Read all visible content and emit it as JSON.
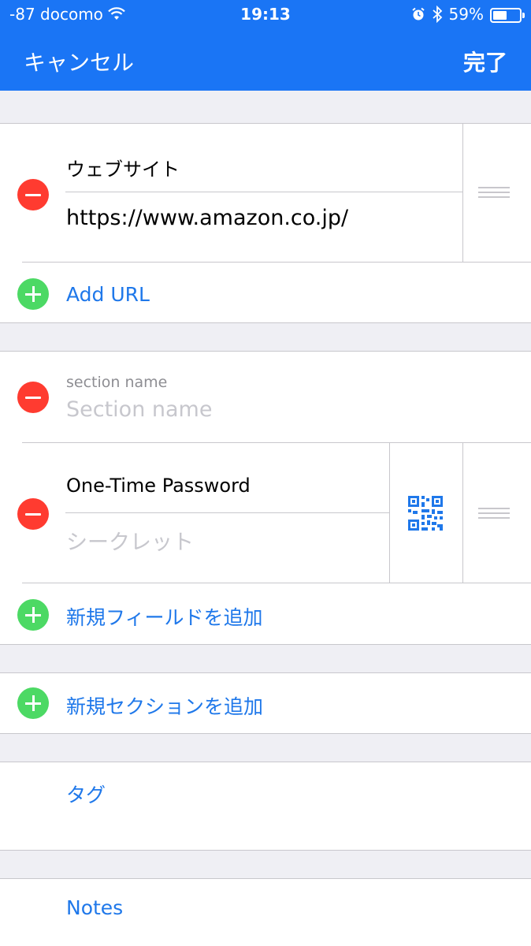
{
  "status_bar": {
    "carrier": "-87 docomo",
    "time": "19:13",
    "battery": "59%",
    "battery_level": 0.59,
    "icons": [
      "wifi-icon",
      "alarm-icon",
      "bluetooth-icon",
      "battery-icon"
    ]
  },
  "nav": {
    "cancel": "キャンセル",
    "done": "完了"
  },
  "website": {
    "label": "ウェブサイト",
    "value": "https://www.amazon.co.jp/",
    "add_url": "Add URL"
  },
  "section": {
    "name_label": "section name",
    "name_placeholder": "Section name",
    "otp_label": "One-Time Password",
    "secret_placeholder": "シークレット",
    "add_field": "新規フィールドを追加"
  },
  "add_section": "新規セクションを追加",
  "tags_label": "タグ",
  "notes_label": "Notes",
  "colors": {
    "nav_blue": "#1a75f5",
    "link_blue": "#1f78ea",
    "delete_red": "#ff3b30",
    "add_green": "#4cd964"
  }
}
